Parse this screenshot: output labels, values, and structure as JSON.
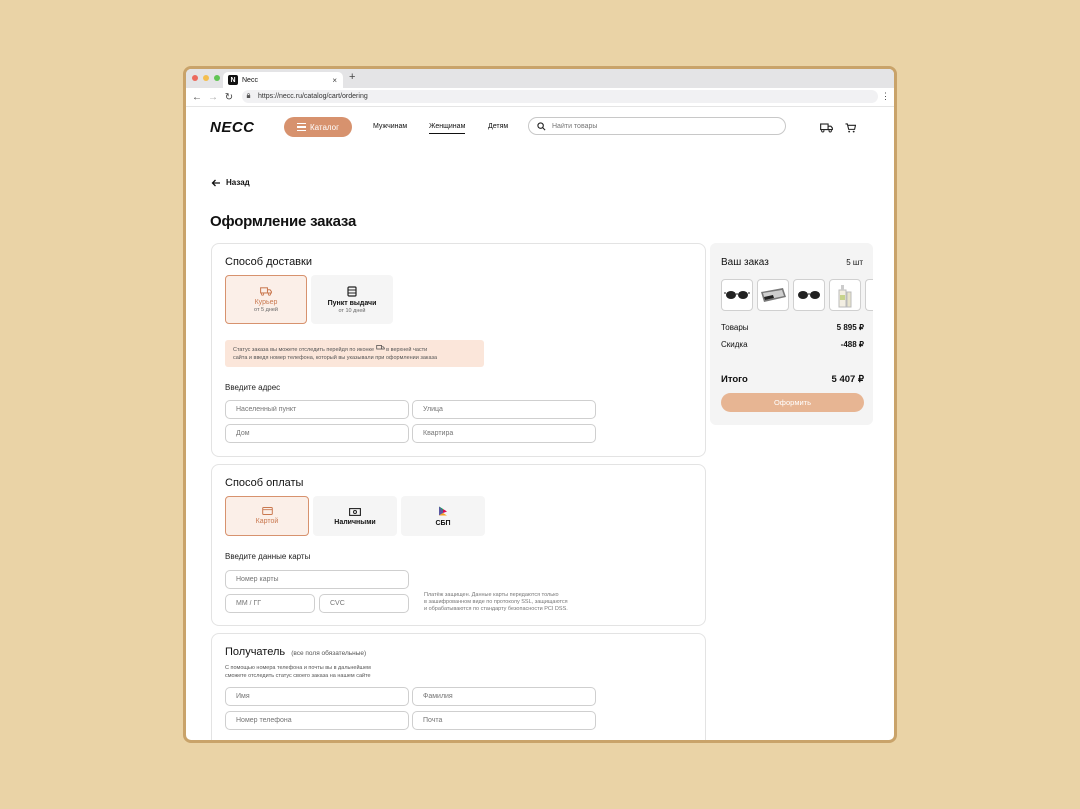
{
  "browser": {
    "tab_title": "Necc",
    "favicon_letter": "N",
    "url": "https://necc.ru/catalog/cart/ordering",
    "new_tab": "+",
    "close_tab": "×"
  },
  "header": {
    "logo": "NECC",
    "catalog_label": "Каталог",
    "nav": [
      "Мужчинам",
      "Женщинам",
      "Детям"
    ],
    "active_nav": "Женщинам",
    "search_placeholder": "Найти товары"
  },
  "page": {
    "back_label": "Назад",
    "title": "Оформление заказа"
  },
  "delivery": {
    "title": "Способ доставки",
    "options": [
      {
        "label": "Курьер",
        "sub": "от 5 дней",
        "icon": "truck-icon",
        "selected": true
      },
      {
        "label": "Пункт выдачи",
        "sub": "от 10 дней",
        "icon": "pickup-point-icon",
        "selected": false
      }
    ],
    "notice_line1": "Статус заказа вы можете отследить перейдя по иконке",
    "notice_line1_end": "в верхней части",
    "notice_line2": "сайта и введя номер телефона, который вы указывали при оформлении заказа",
    "address_title": "Введите адрес",
    "fields": {
      "city": "Населенный пункт",
      "street": "Улица",
      "house": "Дом",
      "apartment": "Квартира"
    }
  },
  "payment": {
    "title": "Способ оплаты",
    "options": [
      {
        "label": "Картой",
        "icon": "card-icon",
        "selected": true
      },
      {
        "label": "Наличными",
        "icon": "cash-icon",
        "selected": false
      },
      {
        "label": "СБП",
        "icon": "sbp-icon",
        "selected": false
      }
    ],
    "card_title": "Введите данные карты",
    "fields": {
      "number": "Номер карты",
      "expiry": "ММ / ГГ",
      "cvc": "CVC"
    },
    "secure_line1": "Платёж защищен. Данные карты передаются только",
    "secure_line2": "в зашифрованном виде по протоколу SSL, защищаются",
    "secure_line3": "и обрабатываются по стандарту безопасности PCI DSS."
  },
  "recipient": {
    "title": "Получатель",
    "title_note": "(все поля обязательные)",
    "hint_line1": "С помощью номера телефона и почты вы в дальнейшем",
    "hint_line2": "сможете отследить статус своего заказа на нашем сайте",
    "fields": {
      "name": "Имя",
      "surname": "Фамилия",
      "phone": "Номер телефона",
      "email": "Почта"
    }
  },
  "summary": {
    "title": "Ваш заказ",
    "count": "5 шт",
    "goods_label": "Товары",
    "goods_value": "5 895 ₽",
    "discount_label": "Скидка",
    "discount_value": "-488 ₽",
    "total_label": "Итого",
    "total_value": "5 407 ₽",
    "submit_label": "Оформить",
    "thumbnails": [
      "sunglasses-thumbnail",
      "keyboard-thumbnail",
      "sunglasses-thumbnail",
      "bottle-thumbnail"
    ]
  },
  "colors": {
    "accent": "#d7926e",
    "accent_light": "#fbefe8",
    "notice_bg": "#fbe6da",
    "submit_bg": "#e7b593",
    "page_bg": "#ead3a6"
  }
}
